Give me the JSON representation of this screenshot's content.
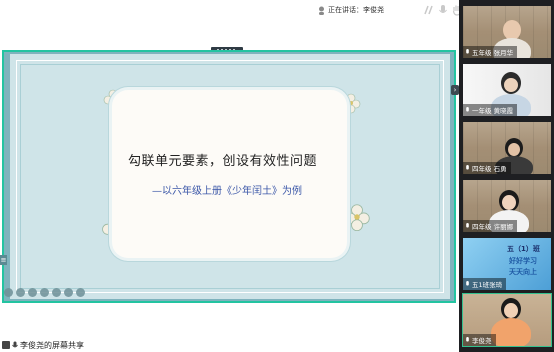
{
  "meeting": {
    "speaking_label": "正在讲话：李俊尧",
    "screen_share_label": "李俊尧的屏幕共享"
  },
  "slide": {
    "title": "勾联单元要素，创设有效性问题",
    "subtitle": "—以六年级上册《少年闰土》为例"
  },
  "participants": [
    {
      "name": "五年级 张月华"
    },
    {
      "name": "一年级 黄晓霞"
    },
    {
      "name": "四年级 石勇"
    },
    {
      "name": "四年级 许丽娜"
    },
    {
      "name": "五1班张琦",
      "screen_text_1": "五（1）班",
      "screen_text_2": "好好学习",
      "screen_text_3": "天天向上"
    },
    {
      "name": "李俊尧"
    }
  ],
  "colors": {
    "share_border": "#23c4a1",
    "slide_bg": "#cfe4e8",
    "subtitle": "#3b57a8",
    "sidebar_bg": "#1e1f22"
  }
}
